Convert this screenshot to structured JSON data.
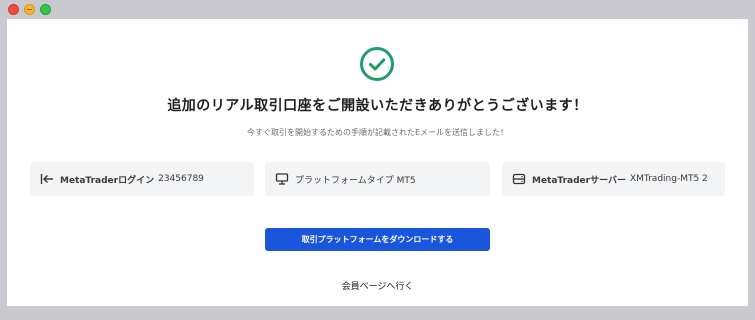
{
  "window": {
    "controls": [
      "close",
      "minimize",
      "maximize"
    ]
  },
  "success": {
    "icon": "check-circle-icon",
    "accent_color": "#1f9d6b",
    "headline": "追加のリアル取引口座をご開設いただきありがとうございます！",
    "subtext": "今すぐ取引を開始するための手順が記載されたEメールを送信しました！"
  },
  "account_details": [
    {
      "icon": "login-arrow-icon",
      "label": "MetaTraderログイン",
      "value": "23456789"
    },
    {
      "icon": "monitor-icon",
      "label": "",
      "value": "プラットフォームタイプ MT5"
    },
    {
      "icon": "server-icon",
      "label": "MetaTraderサーバー",
      "value": "XMTrading-MT5 2"
    }
  ],
  "actions": {
    "download_label": "取引プラットフォームをダウンロードする",
    "download_color": "#1a56db",
    "member_page_label": "会員ページへ行く"
  }
}
